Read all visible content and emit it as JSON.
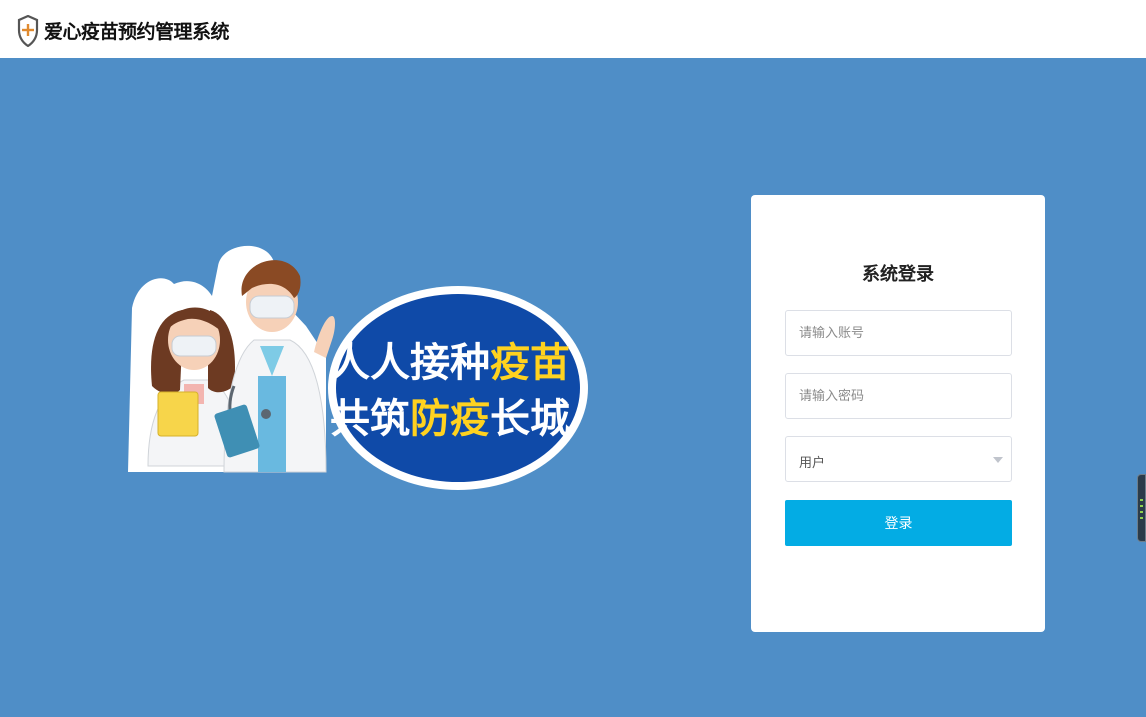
{
  "header": {
    "app_title": "爱心疫苗预约管理系统",
    "logo_icon": "shield-cross-icon"
  },
  "banner": {
    "line1_white": "人人接种",
    "line1_yellow": "疫苗",
    "line2_white_a": "共筑",
    "line2_yellow": "防疫",
    "line2_white_b": "长城",
    "colors": {
      "white_text": "#ffffff",
      "yellow_text": "#ffd21f",
      "ellipse": "#0f4aa8"
    }
  },
  "login": {
    "title": "系统登录",
    "account_placeholder": "请输入账号",
    "password_placeholder": "请输入密码",
    "role_selected": "用户",
    "submit_label": "登录"
  },
  "theme": {
    "background": "#4f8ec7",
    "button": "#03ace4"
  }
}
